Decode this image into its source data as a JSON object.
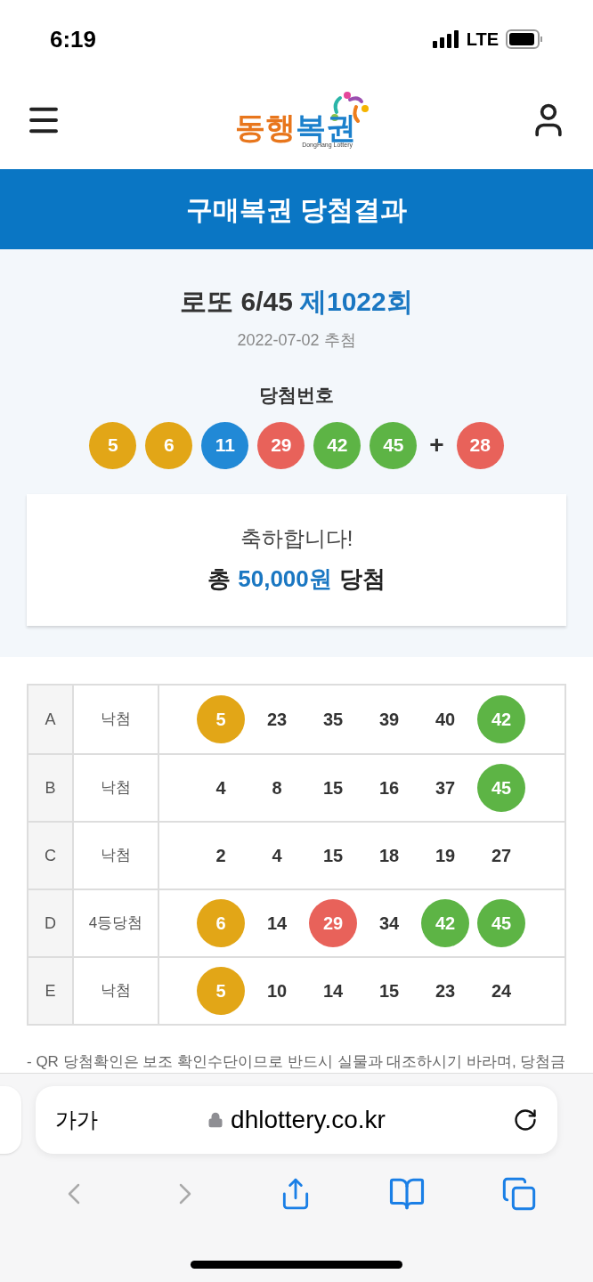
{
  "status_bar": {
    "time": "6:19",
    "network": "LTE"
  },
  "logo": {
    "parts": [
      {
        "text": "동행",
        "color": "#e8761c"
      },
      {
        "text": "복권",
        "color": "#1b80cc"
      }
    ],
    "subtitle": "DongHang Lottery"
  },
  "banner": {
    "title": "구매복권 당첨결과"
  },
  "draw": {
    "game": "로또 6/45",
    "round": "제1022회",
    "date": "2022-07-02 추첨",
    "numbers_label": "당첨번호",
    "numbers": [
      {
        "value": "5",
        "color": "#e2a617"
      },
      {
        "value": "6",
        "color": "#e2a617"
      },
      {
        "value": "11",
        "color": "#2189d6"
      },
      {
        "value": "29",
        "color": "#e8625a"
      },
      {
        "value": "42",
        "color": "#5db445"
      },
      {
        "value": "45",
        "color": "#5db445"
      }
    ],
    "plus": "+",
    "bonus": {
      "value": "28",
      "color": "#e8625a"
    }
  },
  "result": {
    "greeting": "축하합니다!",
    "prefix": "총",
    "amount": "50,000원",
    "suffix": "당첨"
  },
  "tickets": [
    {
      "game": "A",
      "result": "낙첨",
      "numbers": [
        {
          "value": "5",
          "matched": true,
          "color": "#e2a617"
        },
        {
          "value": "23",
          "matched": false
        },
        {
          "value": "35",
          "matched": false
        },
        {
          "value": "39",
          "matched": false
        },
        {
          "value": "40",
          "matched": false
        },
        {
          "value": "42",
          "matched": true,
          "color": "#5db445"
        }
      ]
    },
    {
      "game": "B",
      "result": "낙첨",
      "numbers": [
        {
          "value": "4",
          "matched": false
        },
        {
          "value": "8",
          "matched": false
        },
        {
          "value": "15",
          "matched": false
        },
        {
          "value": "16",
          "matched": false
        },
        {
          "value": "37",
          "matched": false
        },
        {
          "value": "45",
          "matched": true,
          "color": "#5db445"
        }
      ]
    },
    {
      "game": "C",
      "result": "낙첨",
      "numbers": [
        {
          "value": "2",
          "matched": false
        },
        {
          "value": "4",
          "matched": false
        },
        {
          "value": "15",
          "matched": false
        },
        {
          "value": "18",
          "matched": false
        },
        {
          "value": "19",
          "matched": false
        },
        {
          "value": "27",
          "matched": false
        }
      ]
    },
    {
      "game": "D",
      "result": "4등당첨",
      "numbers": [
        {
          "value": "6",
          "matched": true,
          "color": "#e2a617"
        },
        {
          "value": "14",
          "matched": false
        },
        {
          "value": "29",
          "matched": true,
          "color": "#e8625a"
        },
        {
          "value": "34",
          "matched": false
        },
        {
          "value": "42",
          "matched": true,
          "color": "#5db445"
        },
        {
          "value": "45",
          "matched": true,
          "color": "#5db445"
        }
      ]
    },
    {
      "game": "E",
      "result": "낙첨",
      "numbers": [
        {
          "value": "5",
          "matched": true,
          "color": "#e2a617"
        },
        {
          "value": "10",
          "matched": false
        },
        {
          "value": "14",
          "matched": false
        },
        {
          "value": "15",
          "matched": false
        },
        {
          "value": "23",
          "matched": false
        },
        {
          "value": "24",
          "matched": false
        }
      ]
    }
  ],
  "note": "- QR 당첨확인은 보조 확인수단이므로 반드시 실물과 대조하시기 바라며, 당첨금",
  "browser": {
    "text_size": "가가",
    "url": "dhlottery.co.kr"
  }
}
